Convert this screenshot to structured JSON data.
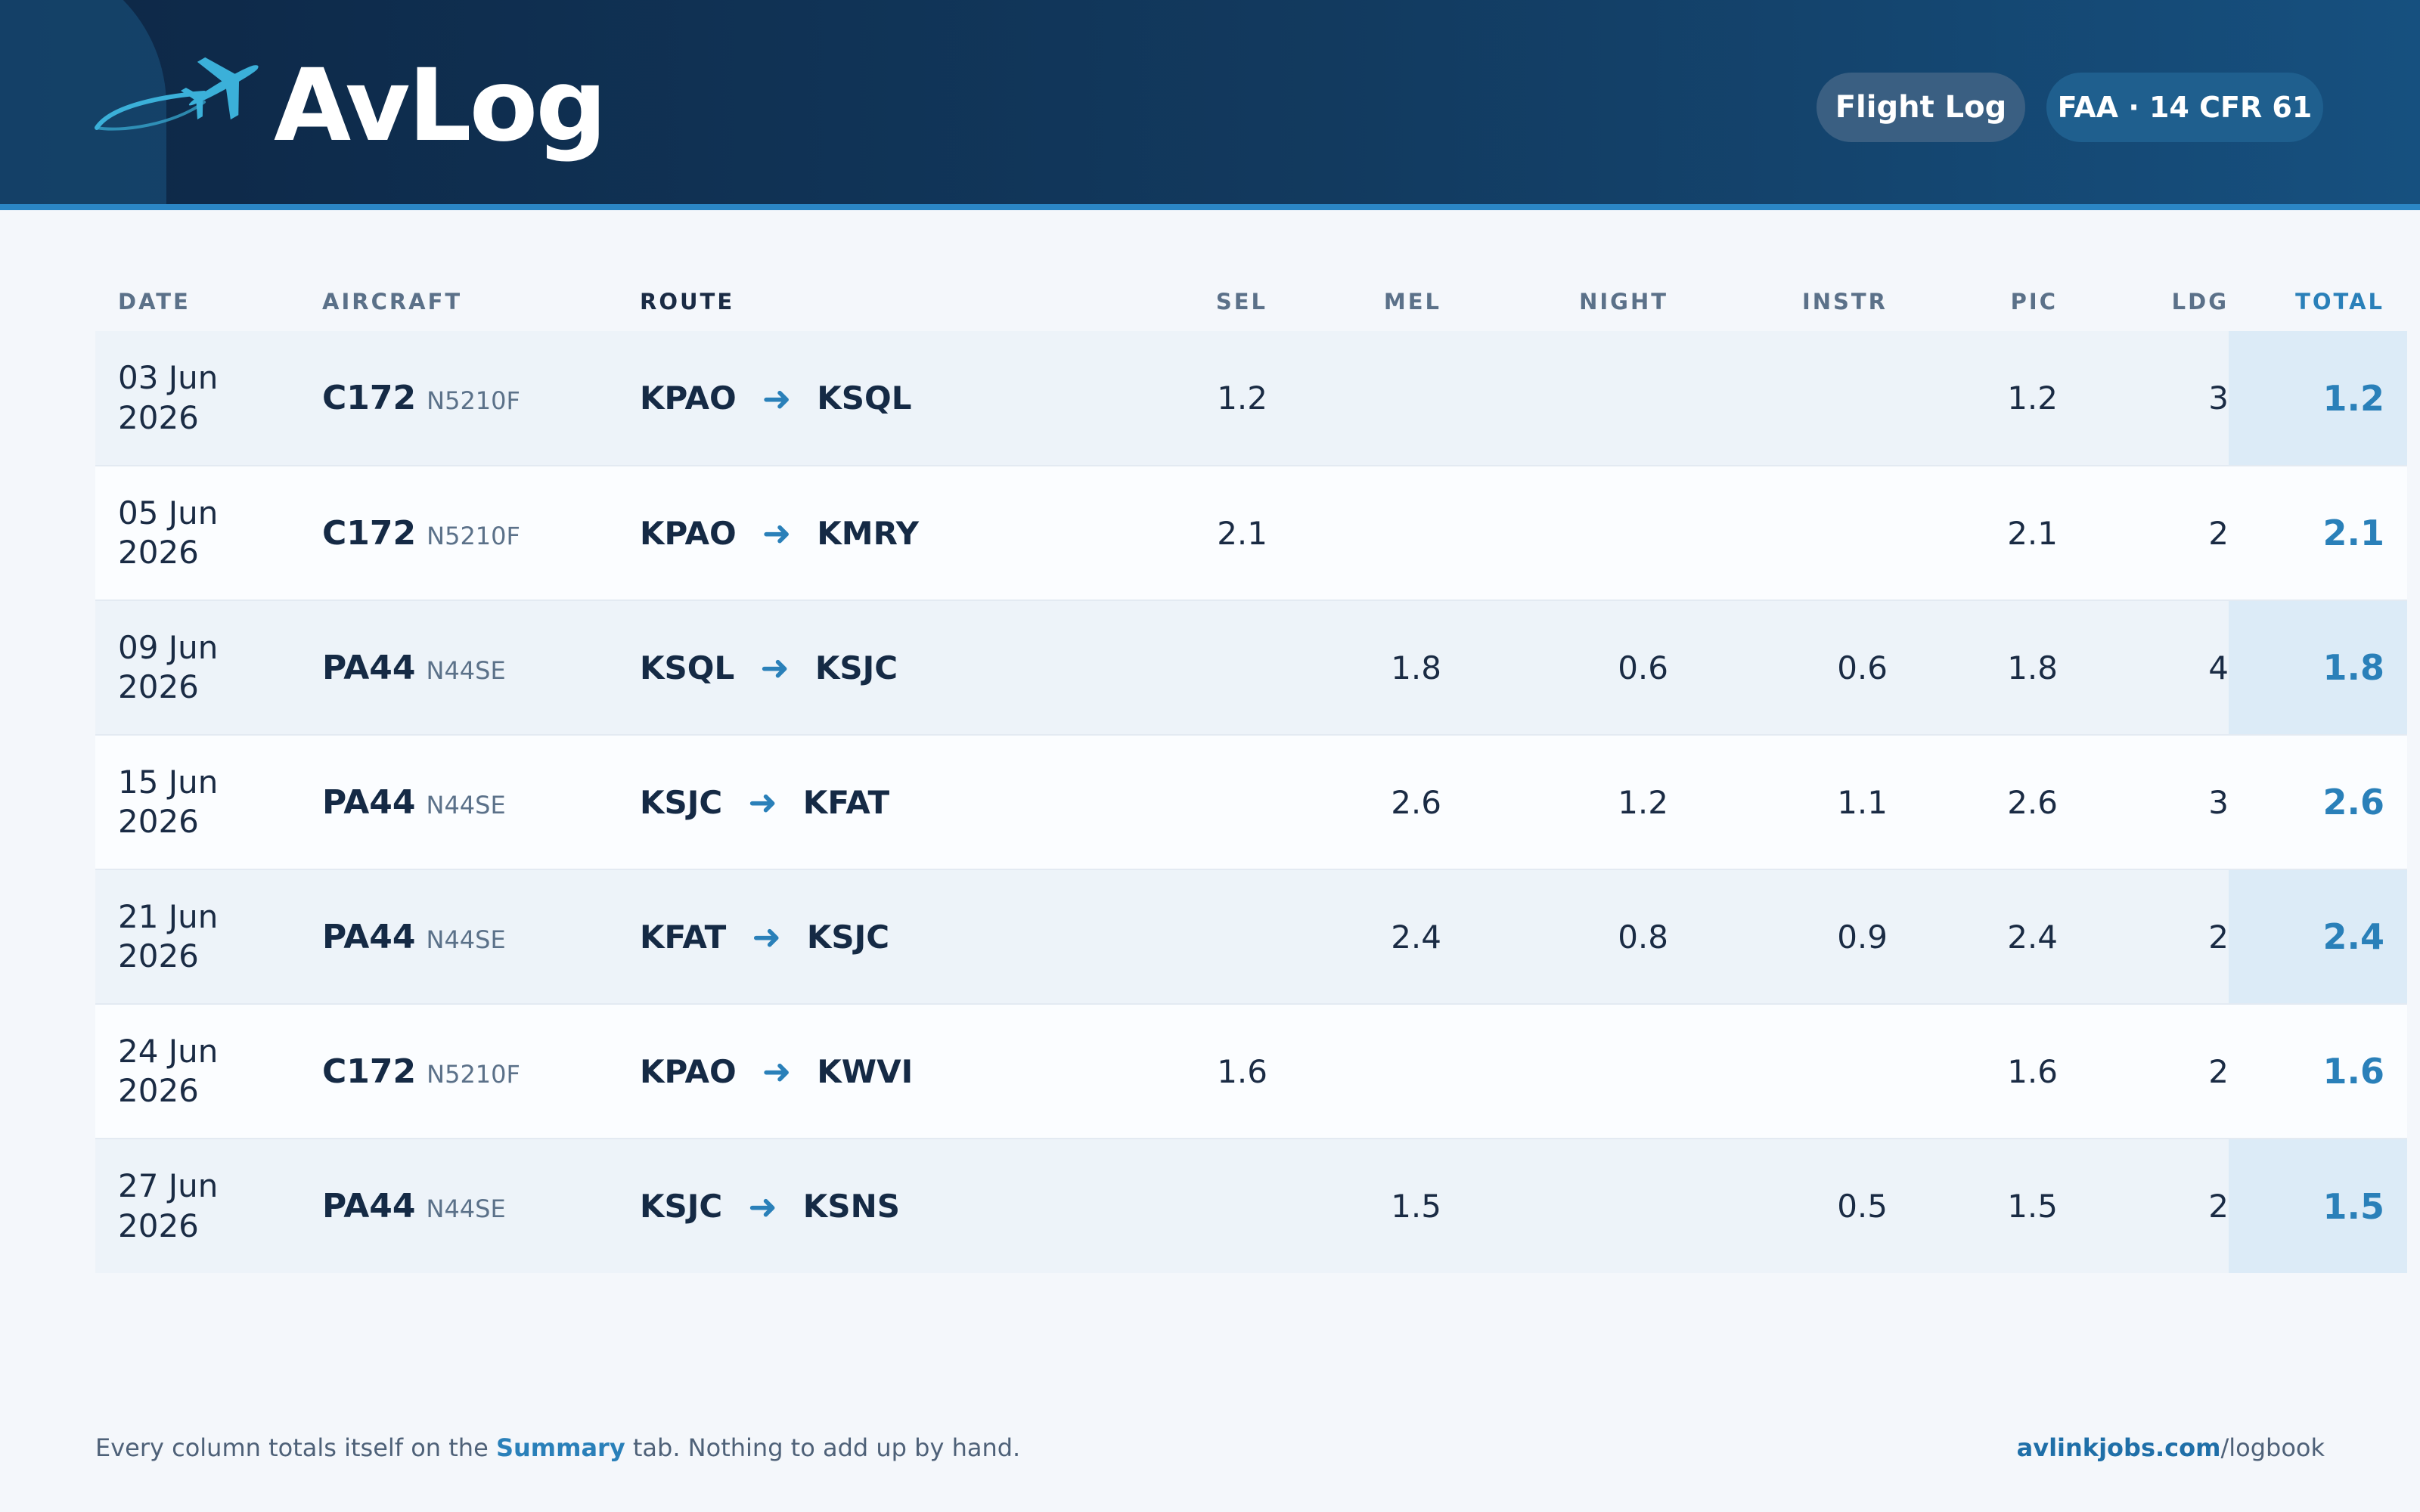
{
  "header": {
    "app_name": "AvLog",
    "pills": [
      "Flight Log",
      "FAA · 14 CFR 61"
    ]
  },
  "colors": {
    "header_bg": "#0d2746",
    "accent": "#2a80b9",
    "total_bg": "#dcebf7",
    "page_bg": "#f4f7fb"
  },
  "table": {
    "columns": [
      "DATE",
      "AIRCRAFT",
      "ROUTE",
      "SEL",
      "MEL",
      "NIGHT",
      "INSTR",
      "PIC",
      "LDG",
      "TOTAL"
    ],
    "rows": [
      {
        "date_line1": "03 Jun",
        "date_line2": "2026",
        "type": "C172",
        "reg": "N5210F",
        "from": "KPAO",
        "to": "KSQL",
        "sel": "1.2",
        "mel": "",
        "night": "",
        "instr": "",
        "pic": "1.2",
        "ldg": "3",
        "total": "1.2"
      },
      {
        "date_line1": "05 Jun",
        "date_line2": "2026",
        "type": "C172",
        "reg": "N5210F",
        "from": "KPAO",
        "to": "KMRY",
        "sel": "2.1",
        "mel": "",
        "night": "",
        "instr": "",
        "pic": "2.1",
        "ldg": "2",
        "total": "2.1"
      },
      {
        "date_line1": "09 Jun",
        "date_line2": "2026",
        "type": "PA44",
        "reg": "N44SE",
        "from": "KSQL",
        "to": "KSJC",
        "sel": "",
        "mel": "1.8",
        "night": "0.6",
        "instr": "0.6",
        "pic": "1.8",
        "ldg": "4",
        "total": "1.8"
      },
      {
        "date_line1": "15 Jun",
        "date_line2": "2026",
        "type": "PA44",
        "reg": "N44SE",
        "from": "KSJC",
        "to": "KFAT",
        "sel": "",
        "mel": "2.6",
        "night": "1.2",
        "instr": "1.1",
        "pic": "2.6",
        "ldg": "3",
        "total": "2.6"
      },
      {
        "date_line1": "21 Jun",
        "date_line2": "2026",
        "type": "PA44",
        "reg": "N44SE",
        "from": "KFAT",
        "to": "KSJC",
        "sel": "",
        "mel": "2.4",
        "night": "0.8",
        "instr": "0.9",
        "pic": "2.4",
        "ldg": "2",
        "total": "2.4"
      },
      {
        "date_line1": "24 Jun",
        "date_line2": "2026",
        "type": "C172",
        "reg": "N5210F",
        "from": "KPAO",
        "to": "KWVI",
        "sel": "1.6",
        "mel": "",
        "night": "",
        "instr": "",
        "pic": "1.6",
        "ldg": "2",
        "total": "1.6"
      },
      {
        "date_line1": "27 Jun",
        "date_line2": "2026",
        "type": "PA44",
        "reg": "N44SE",
        "from": "KSJC",
        "to": "KSNS",
        "sel": "",
        "mel": "1.5",
        "night": "",
        "instr": "0.5",
        "pic": "1.5",
        "ldg": "2",
        "total": "1.5"
      }
    ]
  },
  "footer": {
    "note_before": "Every column totals itself on the ",
    "note_link": "Summary",
    "note_after": " tab. Nothing to add up by hand.",
    "domain": "avlinkjobs.com",
    "path": "/logbook"
  }
}
